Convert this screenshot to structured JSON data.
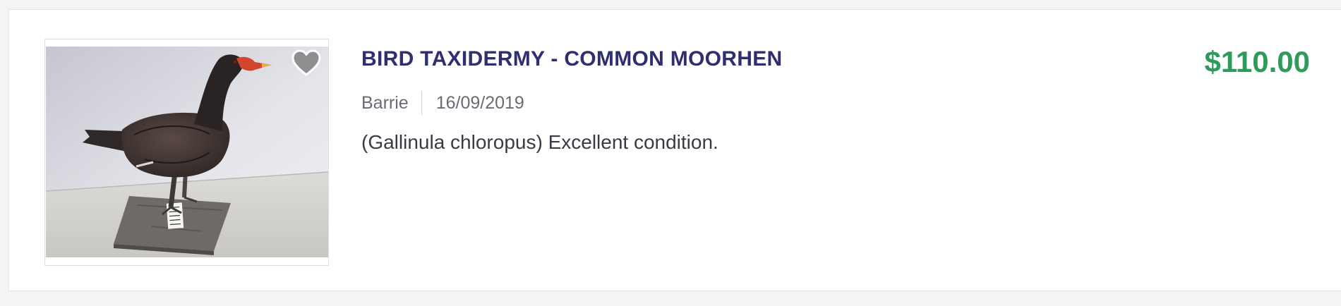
{
  "listing": {
    "title": "BIRD TAXIDERMY - COMMON MOORHEN",
    "location": "Barrie",
    "date": "16/09/2019",
    "description": "(Gallinula chloropus) Excellent condition.",
    "price": "$110.00",
    "image_alt": "Mounted common moorhen on a stone base",
    "favorite_icon": "heart-icon",
    "favorited": false
  },
  "colors": {
    "title": "#2f2e6e",
    "price": "#2e9b5a",
    "meta": "#6b6b78",
    "description": "#3a3a46",
    "card_border": "#e6e6ea"
  }
}
